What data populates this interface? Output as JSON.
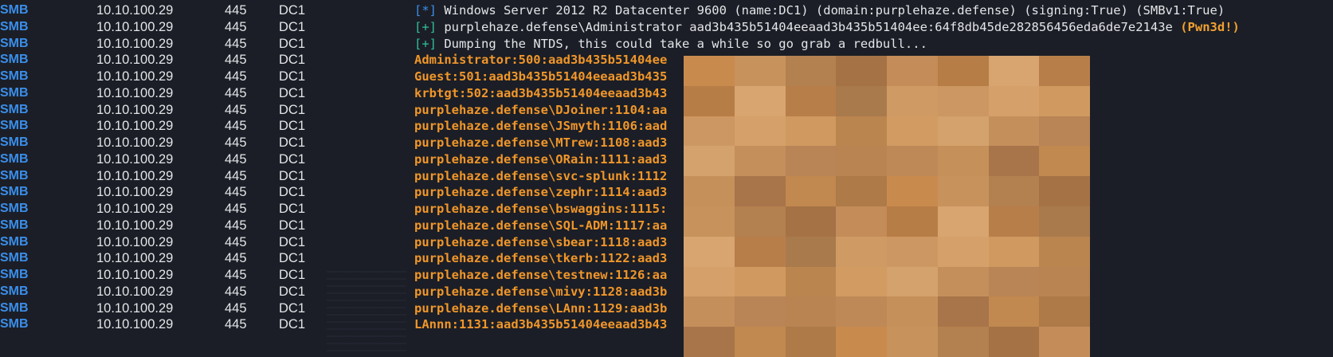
{
  "terminal": {
    "header_lines": [
      {
        "proto": "SMB",
        "ip": "10.10.100.29",
        "port": "445",
        "host": "DC1",
        "tag": "[*]",
        "text": "Windows Server 2012 R2 Datacenter 9600 (name:DC1) (domain:purplehaze.defense) (signing:True) (SMBv1:True)",
        "suffix": ""
      },
      {
        "proto": "SMB",
        "ip": "10.10.100.29",
        "port": "445",
        "host": "DC1",
        "tag": "[+]",
        "text": "purplehaze.defense\\Administrator aad3b435b51404eeaad3b435b51404ee:64f8db45de282856456eda6de7e2143e",
        "suffix": "(Pwn3d!)"
      },
      {
        "proto": "SMB",
        "ip": "10.10.100.29",
        "port": "445",
        "host": "DC1",
        "tag": "[+]",
        "text": "Dumping the NTDS, this could take a while so go grab a redbull...",
        "suffix": ""
      }
    ],
    "hash_lines": [
      {
        "proto": "SMB",
        "ip": "10.10.100.29",
        "port": "445",
        "host": "DC1",
        "text": "Administrator:500:aad3b435b51404ee"
      },
      {
        "proto": "SMB",
        "ip": "10.10.100.29",
        "port": "445",
        "host": "DC1",
        "text": "Guest:501:aad3b435b51404eeaad3b435"
      },
      {
        "proto": "SMB",
        "ip": "10.10.100.29",
        "port": "445",
        "host": "DC1",
        "text": "krbtgt:502:aad3b435b51404eeaad3b43"
      },
      {
        "proto": "SMB",
        "ip": "10.10.100.29",
        "port": "445",
        "host": "DC1",
        "text": "purplehaze.defense\\DJoiner:1104:aa"
      },
      {
        "proto": "SMB",
        "ip": "10.10.100.29",
        "port": "445",
        "host": "DC1",
        "text": "purplehaze.defense\\JSmyth:1106:aad"
      },
      {
        "proto": "SMB",
        "ip": "10.10.100.29",
        "port": "445",
        "host": "DC1",
        "text": "purplehaze.defense\\MTrew:1108:aad3"
      },
      {
        "proto": "SMB",
        "ip": "10.10.100.29",
        "port": "445",
        "host": "DC1",
        "text": "purplehaze.defense\\ORain:1111:aad3"
      },
      {
        "proto": "SMB",
        "ip": "10.10.100.29",
        "port": "445",
        "host": "DC1",
        "text": "purplehaze.defense\\svc-splunk:1112"
      },
      {
        "proto": "SMB",
        "ip": "10.10.100.29",
        "port": "445",
        "host": "DC1",
        "text": "purplehaze.defense\\zephr:1114:aad3"
      },
      {
        "proto": "SMB",
        "ip": "10.10.100.29",
        "port": "445",
        "host": "DC1",
        "text": "purplehaze.defense\\bswaggins:1115:"
      },
      {
        "proto": "SMB",
        "ip": "10.10.100.29",
        "port": "445",
        "host": "DC1",
        "text": "purplehaze.defense\\SQL-ADM:1117:aa"
      },
      {
        "proto": "SMB",
        "ip": "10.10.100.29",
        "port": "445",
        "host": "DC1",
        "text": "purplehaze.defense\\sbear:1118:aad3"
      },
      {
        "proto": "SMB",
        "ip": "10.10.100.29",
        "port": "445",
        "host": "DC1",
        "text": "purplehaze.defense\\tkerb:1122:aad3"
      },
      {
        "proto": "SMB",
        "ip": "10.10.100.29",
        "port": "445",
        "host": "DC1",
        "text": "purplehaze.defense\\testnew:1126:aa"
      },
      {
        "proto": "SMB",
        "ip": "10.10.100.29",
        "port": "445",
        "host": "DC1",
        "text": "purplehaze.defense\\mivy:1128:aad3b"
      },
      {
        "proto": "SMB",
        "ip": "10.10.100.29",
        "port": "445",
        "host": "DC1",
        "text": "purplehaze.defense\\LAnn:1129:aad3b"
      },
      {
        "proto": "SMB",
        "ip": "10.10.100.29",
        "port": "445",
        "host": "DC1",
        "text": "LAnnn:1131:aad3b435b51404eeaad3b43"
      }
    ],
    "colors": {
      "background": "#1b1e26",
      "protocol": "#3b8eea",
      "text": "#e3e5e8",
      "hash": "#f0962a",
      "ok_tag": "#2fbf9a",
      "pwned": "#f0a030"
    },
    "redaction_palette": [
      "#c98a4e",
      "#b87e4a",
      "#d29b62",
      "#a8744a",
      "#c48c58",
      "#d6a06a",
      "#b98352",
      "#c7925c",
      "#a97a4c",
      "#d4a26c",
      "#c1894f",
      "#b77d46",
      "#cf9960",
      "#be8957",
      "#b3804f",
      "#d09a64",
      "#c48f5b",
      "#ad7a48",
      "#d8a470",
      "#bb8550",
      "#c6905a",
      "#a57246",
      "#cc9762",
      "#b98456"
    ]
  }
}
